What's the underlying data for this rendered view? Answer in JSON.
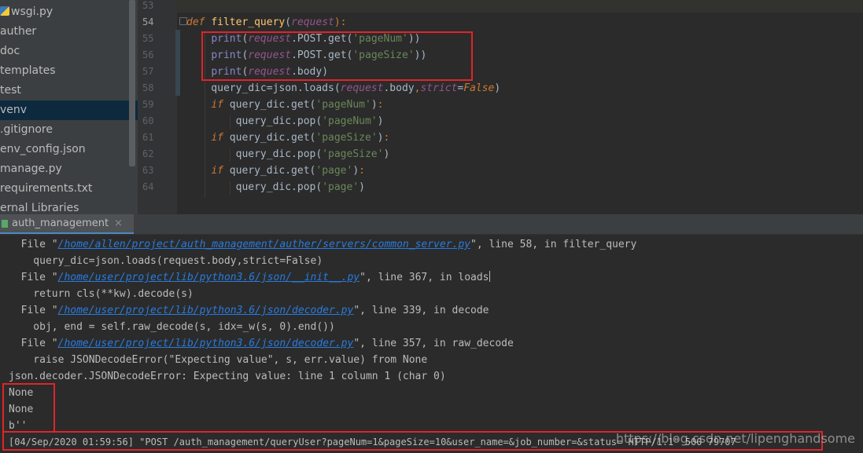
{
  "project_tree": {
    "items": [
      {
        "label": "wsgi.py",
        "icon": "python-file-icon",
        "selected": false
      },
      {
        "label": "auther",
        "selected": false
      },
      {
        "label": "doc",
        "selected": false
      },
      {
        "label": "templates",
        "selected": false
      },
      {
        "label": "test",
        "selected": false
      },
      {
        "label": "venv",
        "selected": true
      },
      {
        "label": ".gitignore",
        "selected": false
      },
      {
        "label": "env_config.json",
        "selected": false
      },
      {
        "label": "manage.py",
        "selected": false
      },
      {
        "label": "requirements.txt",
        "selected": false
      },
      {
        "label": "ernal Libraries",
        "selected": false
      }
    ]
  },
  "editor": {
    "line_numbers": [
      "53",
      "54",
      "55",
      "56",
      "57",
      "58",
      "59",
      "60",
      "61",
      "62",
      "63",
      "64"
    ],
    "current_line": "54"
  },
  "run_panel": {
    "tab_label": "auth_management",
    "close_glyph": "×",
    "console": {
      "l1_pre": "  File \"",
      "l1_link": "/home/allen/project/auth_management/auther/servers/common_server.py",
      "l1_post": "\", line 58, in filter_query",
      "l2": "    query_dic=json.loads(request.body,strict=False)",
      "l3_pre": "  File \"",
      "l3_link": "/home/user/project/lib/python3.6/json/__init__.py",
      "l3_post": "\", line 367, in loads",
      "l4": "    return cls(**kw).decode(s)",
      "l5_pre": "  File \"",
      "l5_link": "/home/user/project/lib/python3.6/json/decoder.py",
      "l5_post": "\", line 339, in decode",
      "l6": "    obj, end = self.raw_decode(s, idx=_w(s, 0).end())",
      "l7_pre": "  File \"",
      "l7_link": "/home/user/project/lib/python3.6/json/decoder.py",
      "l7_post": "\", line 357, in raw_decode",
      "l8": "    raise JSONDecodeError(\"Expecting value\", s, err.value) from None",
      "l9": "json.decoder.JSONDecodeError: Expecting value: line 1 column 1 (char 0)",
      "l10": "None",
      "l11": "None",
      "l12": "b''",
      "l13": "[04/Sep/2020 01:59:56] \"POST /auth_management/queryUser?pageNum=1&pageSize=10&user_name=&job_number=&status= HTTP/1.1\" 500 79707"
    }
  },
  "watermark": "https://blog.csdn.net/lipenghandsome",
  "colors": {
    "editor_bg": "#2b2b2b",
    "sidebar_bg": "#3c3f41",
    "selection": "#0d293e",
    "highlight_box": "#e0242a",
    "link": "#287bde"
  }
}
